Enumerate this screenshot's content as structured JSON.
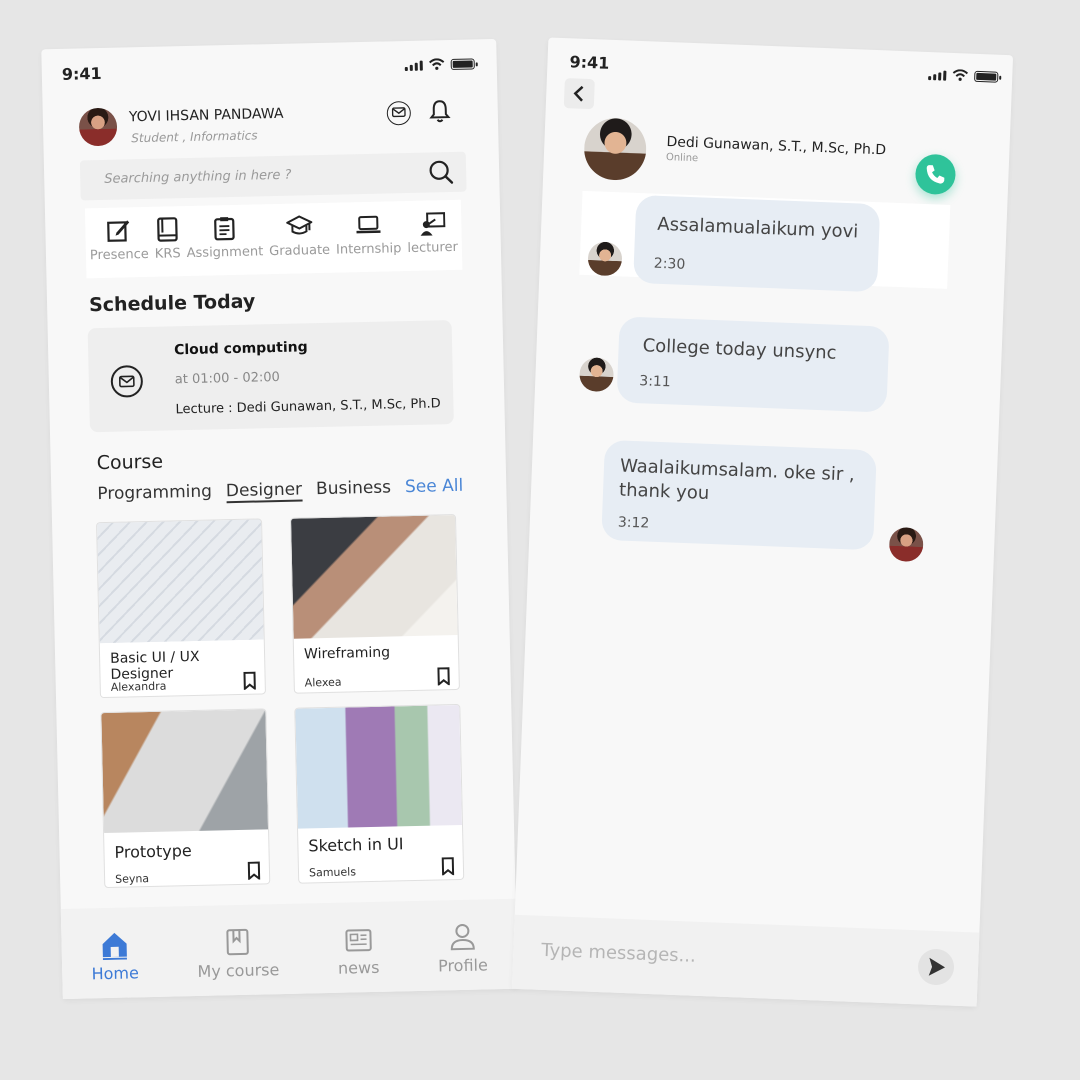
{
  "status": {
    "time": "9:41"
  },
  "home": {
    "user": {
      "name": "YOVI IHSAN PANDAWA",
      "role": "Student , Informatics"
    },
    "search": {
      "placeholder": "Searching anything in here ?"
    },
    "quick_menu": [
      {
        "label": "Presence",
        "icon": "edit-icon"
      },
      {
        "label": "KRS",
        "icon": "book-icon"
      },
      {
        "label": "Assignment",
        "icon": "clipboard-icon"
      },
      {
        "label": "Graduate",
        "icon": "graduation-cap-icon"
      },
      {
        "label": "Internship",
        "icon": "laptop-icon"
      },
      {
        "label": "lecturer",
        "icon": "presenter-icon"
      }
    ],
    "schedule": {
      "heading": "Schedule Today",
      "course": "Cloud computing",
      "time": "at 01:00 - 02:00",
      "lecturer": "Lecture : Dedi Gunawan, S.T., M.Sc, Ph.D"
    },
    "course": {
      "heading": "Course",
      "categories": [
        "Programming",
        "Designer",
        "Business"
      ],
      "active_category": "Designer",
      "see_all": "See All",
      "cards": [
        {
          "title": "Basic UI / UX Designer",
          "author": "Alexandra"
        },
        {
          "title": "Wireframing",
          "author": "Alexea"
        },
        {
          "title": "Prototype",
          "author": "Seyna"
        },
        {
          "title": "Sketch in UI",
          "author": "Samuels"
        }
      ]
    },
    "nav": [
      {
        "label": "Home",
        "icon": "home-icon",
        "active": true
      },
      {
        "label": "My course",
        "icon": "bookmark-book-icon",
        "active": false
      },
      {
        "label": "news",
        "icon": "newspaper-icon",
        "active": false
      },
      {
        "label": "Profile",
        "icon": "user-icon",
        "active": false
      }
    ]
  },
  "chat": {
    "contact": {
      "name": "Dedi Gunawan, S.T., M.Sc, Ph.D",
      "status": "Online"
    },
    "messages": [
      {
        "text": "Assalamualaikum yovi",
        "time": "2:30",
        "from": "contact"
      },
      {
        "text": "College today unsync",
        "time": "3:11",
        "from": "contact"
      },
      {
        "text": "Waalaikumsalam. oke sir ,\nthank you",
        "time": "3:12",
        "from": "me"
      }
    ],
    "input": {
      "placeholder": "Type messages..."
    }
  },
  "colors": {
    "accent": "#4a86d6",
    "call": "#2fc39a",
    "bubble": "#e7edf4",
    "background": "#e6e6e6"
  }
}
